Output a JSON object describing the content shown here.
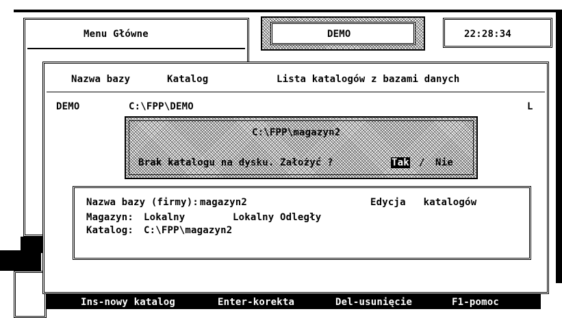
{
  "top": {
    "menu_title": "Menu Główne",
    "demo_title": "DEMO",
    "clock": "22:28:34"
  },
  "catalog_window": {
    "header_name": "Nazwa bazy",
    "header_catalog": "Katalog",
    "header_title": "Lista katalogów z bazami danych",
    "rows": [
      {
        "name": "DEMO",
        "path": "C:\\FPP\\DEMO",
        "flag": "L"
      }
    ]
  },
  "dialog": {
    "path": "C:\\FPP\\magazyn2",
    "message": "Brak katalogu na dysku. Założyć ?",
    "yes": "Tak",
    "separator": "/",
    "no": "Nie"
  },
  "edit_box": {
    "db_label": "Nazwa bazy (firmy):",
    "db_value": "magazyn2",
    "section_title": "Edycja   katalogów",
    "warehouse_label": "Magazyn:",
    "warehouse_local": "Lokalny",
    "warehouse_remote": "Lokalny Odległy",
    "catalog_label": "Katalog:",
    "catalog_value": "C:\\FPP\\magazyn2"
  },
  "status_bar": {
    "ins": "Ins-nowy katalog",
    "enter": "Enter-korekta",
    "del": "Del-usunięcie",
    "help": "F1-pomoc"
  }
}
